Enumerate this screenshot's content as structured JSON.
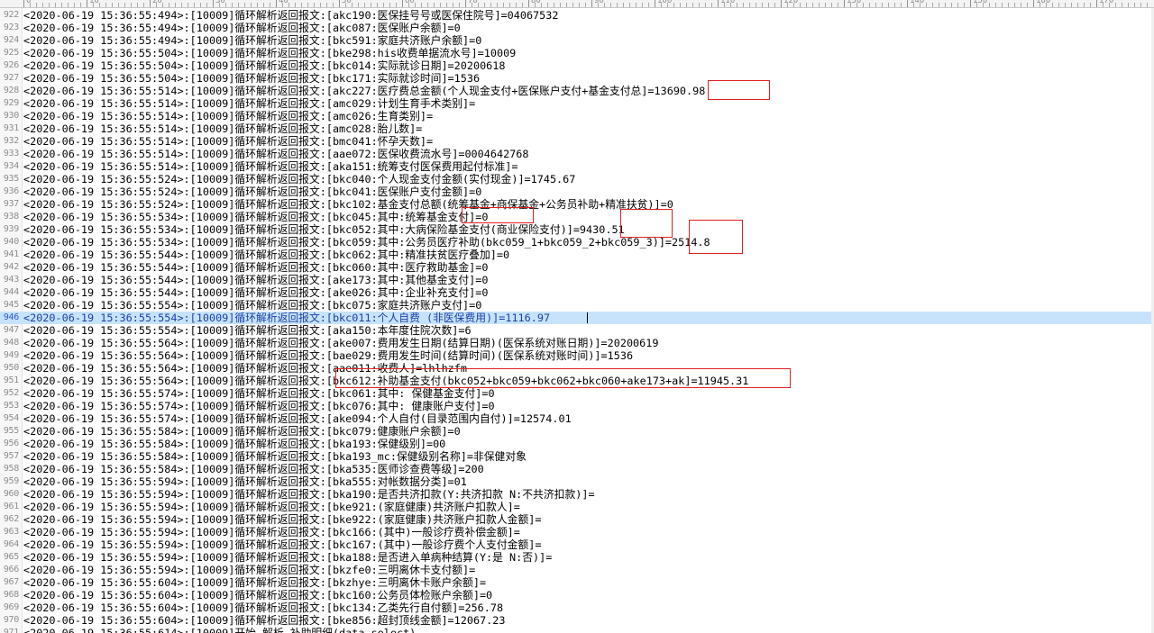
{
  "ruler": {
    "labels": [
      "0",
      "10",
      "20",
      "30",
      "40",
      "50",
      "60",
      "70",
      "80",
      "90",
      "100",
      "110",
      "120",
      "130",
      "140",
      "150",
      "160",
      "170"
    ]
  },
  "editor": {
    "current_line_number": "946",
    "lines": [
      {
        "n": "922",
        "t": "<2020-06-19 15:36:55:494>:[10009]循环解析返回报文:[akc190:医保挂号号或医保住院号]=04067532"
      },
      {
        "n": "923",
        "t": "<2020-06-19 15:36:55:494>:[10009]循环解析返回报文:[akc087:医保账户余额]=0"
      },
      {
        "n": "924",
        "t": "<2020-06-19 15:36:55:494>:[10009]循环解析返回报文:[bkc591:家庭共济账户余额]=0"
      },
      {
        "n": "925",
        "t": "<2020-06-19 15:36:55:504>:[10009]循环解析返回报文:[bke298:his收费单据流水号]=10009"
      },
      {
        "n": "926",
        "t": "<2020-06-19 15:36:55:504>:[10009]循环解析返回报文:[bkc014:实际就诊日期]=20200618"
      },
      {
        "n": "927",
        "t": "<2020-06-19 15:36:55:504>:[10009]循环解析返回报文:[bkc171:实际就诊时间]=1536"
      },
      {
        "n": "928",
        "t": "<2020-06-19 15:36:55:514>:[10009]循环解析返回报文:[akc227:医疗费总金额(个人现金支付+医保账户支付+基金支付总]=13690.98"
      },
      {
        "n": "929",
        "t": "<2020-06-19 15:36:55:514>:[10009]循环解析返回报文:[amc029:计划生育手术类别]="
      },
      {
        "n": "930",
        "t": "<2020-06-19 15:36:55:514>:[10009]循环解析返回报文:[amc026:生育类别]="
      },
      {
        "n": "931",
        "t": "<2020-06-19 15:36:55:514>:[10009]循环解析返回报文:[amc028:胎儿数]="
      },
      {
        "n": "932",
        "t": "<2020-06-19 15:36:55:514>:[10009]循环解析返回报文:[bmc041:怀孕天数]="
      },
      {
        "n": "933",
        "t": "<2020-06-19 15:36:55:514>:[10009]循环解析返回报文:[aae072:医保收费流水号]=0004642768"
      },
      {
        "n": "934",
        "t": "<2020-06-19 15:36:55:514>:[10009]循环解析返回报文:[aka151:统筹支付医保费用起付标准]="
      },
      {
        "n": "935",
        "t": "<2020-06-19 15:36:55:524>:[10009]循环解析返回报文:[bkc040:个人现金支付金额(实付现金)]=1745.67"
      },
      {
        "n": "936",
        "t": "<2020-06-19 15:36:55:524>:[10009]循环解析返回报文:[bkc041:医保账户支付金额]=0"
      },
      {
        "n": "937",
        "t": "<2020-06-19 15:36:55:524>:[10009]循环解析返回报文:[bkc102:基金支付总额(统筹基金+商保基金+公务员补助+精准扶贫)]=0"
      },
      {
        "n": "938",
        "t": "<2020-06-19 15:36:55:534>:[10009]循环解析返回报文:[bkc045:其中:统筹基金支付]=0"
      },
      {
        "n": "939",
        "t": "<2020-06-19 15:36:55:534>:[10009]循环解析返回报文:[bkc052:其中:大病保险基金支付(商业保险支付)]=9430.51"
      },
      {
        "n": "940",
        "t": "<2020-06-19 15:36:55:534>:[10009]循环解析返回报文:[bkc059:其中:公务员医疗补助(bkc059_1+bkc059_2+bkc059_3)]=2514.8"
      },
      {
        "n": "941",
        "t": "<2020-06-19 15:36:55:544>:[10009]循环解析返回报文:[bkc062:其中:精准扶贫医疗叠加]=0"
      },
      {
        "n": "942",
        "t": "<2020-06-19 15:36:55:544>:[10009]循环解析返回报文:[bkc060:其中:医疗救助基金]=0"
      },
      {
        "n": "943",
        "t": "<2020-06-19 15:36:55:544>:[10009]循环解析返回报文:[ake173:其中:其他基金支付]=0"
      },
      {
        "n": "944",
        "t": "<2020-06-19 15:36:55:544>:[10009]循环解析返回报文:[ake026:其中:企业补充支付]=0"
      },
      {
        "n": "945",
        "t": "<2020-06-19 15:36:55:554>:[10009]循环解析返回报文:[bkc075:家庭共济账户支付]=0"
      },
      {
        "n": "946",
        "t": "<2020-06-19 15:36:55:554>:[10009]循环解析返回报文:[bkc011:个人自费 (非医保费用)]=1116.97"
      },
      {
        "n": "947",
        "t": "<2020-06-19 15:36:55:554>:[10009]循环解析返回报文:[aka150:本年度住院次数]=6"
      },
      {
        "n": "948",
        "t": "<2020-06-19 15:36:55:564>:[10009]循环解析返回报文:[ake007:费用发生日期(结算日期)(医保系统对账日期)]=20200619"
      },
      {
        "n": "949",
        "t": "<2020-06-19 15:36:55:564>:[10009]循环解析返回报文:[bae029:费用发生时间(结算时间)(医保系统对账时间)]=1536"
      },
      {
        "n": "950",
        "t": "<2020-06-19 15:36:55:564>:[10009]循环解析返回报文:[aae011:收费人]=lhlhzfm"
      },
      {
        "n": "951",
        "t": "<2020-06-19 15:36:55:564>:[10009]循环解析返回报文:[bkc612:补助基金支付(bkc052+bkc059+bkc062+bkc060+ake173+ak]=11945.31"
      },
      {
        "n": "952",
        "t": "<2020-06-19 15:36:55:574>:[10009]循环解析返回报文:[bkc061:其中: 保健基金支付]=0"
      },
      {
        "n": "953",
        "t": "<2020-06-19 15:36:55:574>:[10009]循环解析返回报文:[bkc076:其中: 健康账户支付]=0"
      },
      {
        "n": "954",
        "t": "<2020-06-19 15:36:55:574>:[10009]循环解析返回报文:[ake094:个人自付(目录范围内自付)]=12574.01"
      },
      {
        "n": "955",
        "t": "<2020-06-19 15:36:55:584>:[10009]循环解析返回报文:[bkc079:健康账户余额]=0"
      },
      {
        "n": "956",
        "t": "<2020-06-19 15:36:55:584>:[10009]循环解析返回报文:[bka193:保健级别]=00"
      },
      {
        "n": "957",
        "t": "<2020-06-19 15:36:55:584>:[10009]循环解析返回报文:[bka193_mc:保健级别名称]=非保健对象"
      },
      {
        "n": "958",
        "t": "<2020-06-19 15:36:55:584>:[10009]循环解析返回报文:[bka535:医师诊查费等级]=200"
      },
      {
        "n": "959",
        "t": "<2020-06-19 15:36:55:594>:[10009]循环解析返回报文:[bka555:对帐数据分类]=01"
      },
      {
        "n": "960",
        "t": "<2020-06-19 15:36:55:594>:[10009]循环解析返回报文:[bka190:是否共济扣款(Y:共济扣款 N:不共济扣款)]="
      },
      {
        "n": "961",
        "t": "<2020-06-19 15:36:55:594>:[10009]循环解析返回报文:[bke921:(家庭健康)共济账户扣款人]="
      },
      {
        "n": "962",
        "t": "<2020-06-19 15:36:55:594>:[10009]循环解析返回报文:[bke922:(家庭健康)共济账户扣款人金额]="
      },
      {
        "n": "963",
        "t": "<2020-06-19 15:36:55:594>:[10009]循环解析返回报文:[bkc166:(其中)一般诊疗费补偿金额]="
      },
      {
        "n": "964",
        "t": "<2020-06-19 15:36:55:594>:[10009]循环解析返回报文:[bkc167:(其中)一般诊疗费个人支付金额]="
      },
      {
        "n": "965",
        "t": "<2020-06-19 15:36:55:594>:[10009]循环解析返回报文:[bka188:是否进入单病种结算(Y:是 N:否)]="
      },
      {
        "n": "966",
        "t": "<2020-06-19 15:36:55:594>:[10009]循环解析返回报文:[bkzfe0:三明离休卡支付额]="
      },
      {
        "n": "967",
        "t": "<2020-06-19 15:36:55:604>:[10009]循环解析返回报文:[bkzhye:三明离休卡账户余额]="
      },
      {
        "n": "968",
        "t": "<2020-06-19 15:36:55:604>:[10009]循环解析返回报文:[bkc160:公务员体检账户余额]=0"
      },
      {
        "n": "969",
        "t": "<2020-06-19 15:36:55:604>:[10009]循环解析返回报文:[bkc134:乙类先行自付额]=256.78"
      },
      {
        "n": "970",
        "t": "<2020-06-19 15:36:55:604>:[10009]循环解析返回报文:[bke856:超封顶线金额]=12067.23"
      },
      {
        "n": "971",
        "t": "<2020-06-19 15:36:55:614>:[10009]开始 解析 补助明细(data_select)"
      }
    ]
  }
}
